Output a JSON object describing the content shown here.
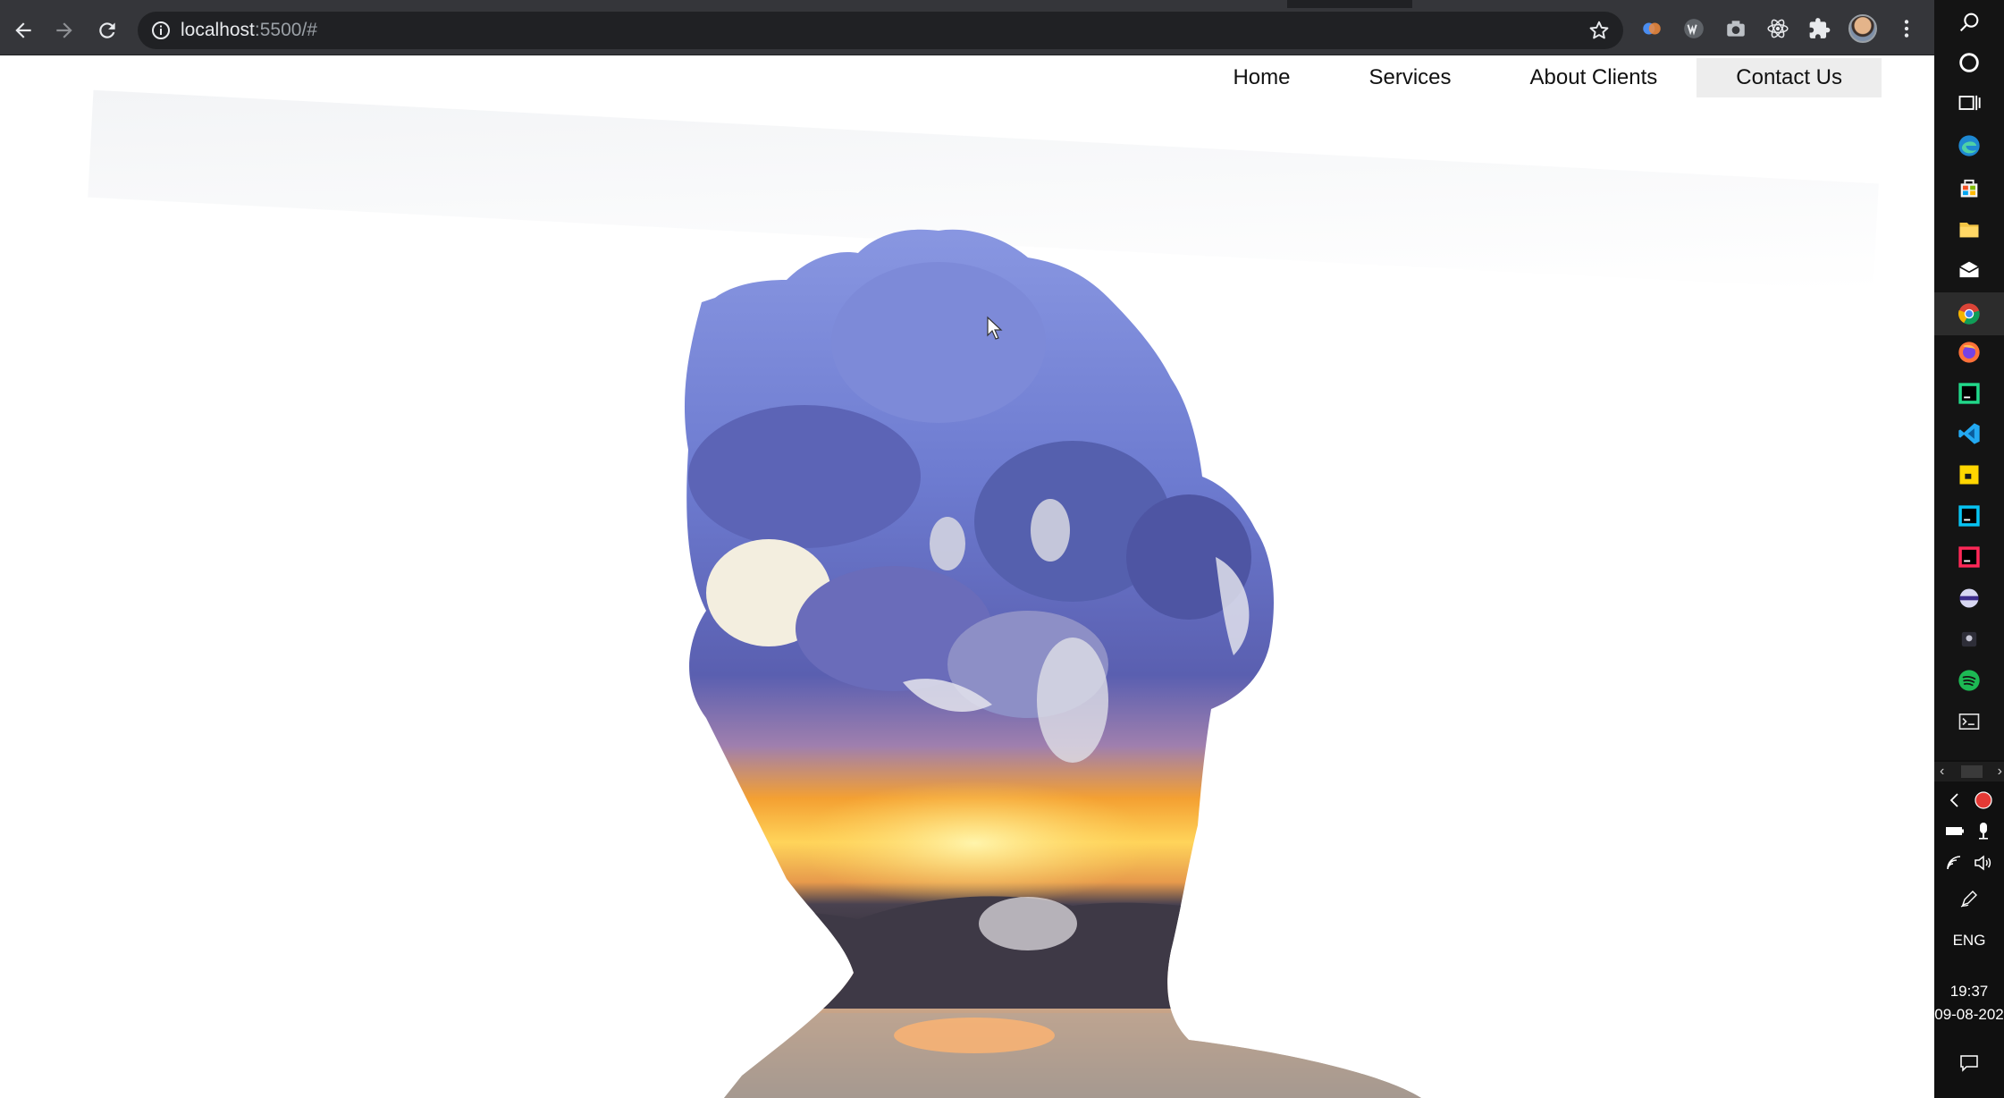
{
  "browser": {
    "url_host": "localhost",
    "url_path": ":5500/#",
    "icons": {
      "back": "arrow-left-icon",
      "forward": "arrow-right-icon",
      "reload": "reload-icon",
      "site_info": "info-icon",
      "bookmark": "star-icon",
      "extensions": [
        "dualless-icon",
        "w-extension-icon",
        "camera-icon",
        "react-devtools-icon",
        "puzzle-icon"
      ],
      "profile": "avatar",
      "menu": "kebab-menu-icon"
    }
  },
  "site_nav": {
    "items": [
      {
        "label": "Home"
      },
      {
        "label": "Services"
      },
      {
        "label": "About Clients"
      },
      {
        "label": "Contact Us",
        "active": true
      }
    ]
  },
  "hero": {
    "image": "double-exposure-head-silhouette-sunset-clouds",
    "colors": {
      "sky_blue": "#6f7fd0",
      "cloud_white": "#e7e9f5",
      "sunset_orange": "#f6a323",
      "sun_yellow": "#ffe06a",
      "hills": "#3f3a46",
      "water": "#b9a89a"
    }
  },
  "taskbar": {
    "icons": [
      "search-icon",
      "cortana-icon",
      "task-view-icon",
      "edge-icon",
      "store-icon",
      "file-explorer-icon",
      "mail-icon",
      "chrome-icon",
      "firefox-icon",
      "pycharm-icon",
      "vscode-icon",
      "sticky-notes-icon",
      "webstorm-icon",
      "intellij-icon",
      "app-icon",
      "app2-icon",
      "spotify-icon",
      "terminal-icon"
    ],
    "tray": {
      "language": "ENG",
      "time": "19:37",
      "date": "09-08-202"
    }
  },
  "accent": "#1a73e8"
}
